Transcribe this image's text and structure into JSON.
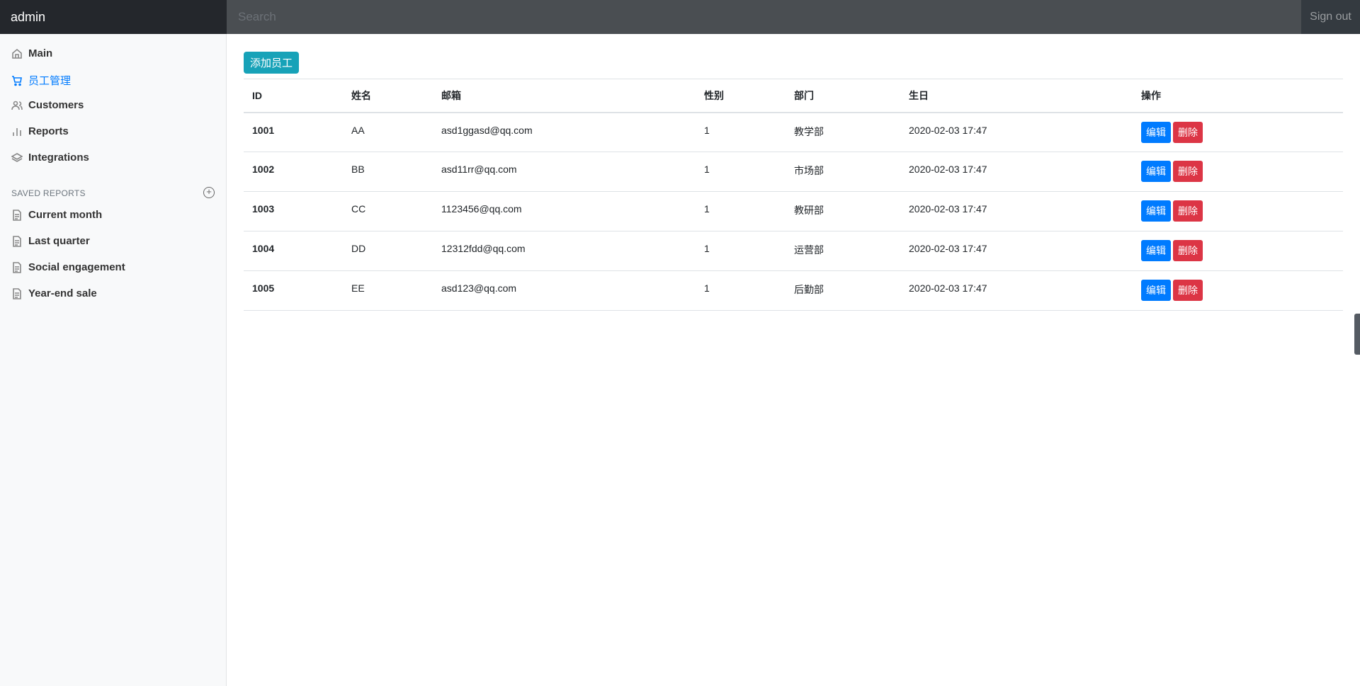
{
  "header": {
    "brand": "admin",
    "search_placeholder": "Search",
    "sign_out": "Sign out"
  },
  "sidebar": {
    "items": [
      {
        "label": "Main",
        "icon": "home-icon"
      },
      {
        "label": "员工管理",
        "icon": "cart-icon",
        "active": true
      },
      {
        "label": "Customers",
        "icon": "users-icon"
      },
      {
        "label": "Reports",
        "icon": "bar-chart-icon"
      },
      {
        "label": "Integrations",
        "icon": "layers-icon"
      }
    ],
    "saved_reports_title": "SAVED REPORTS",
    "saved_reports": [
      {
        "label": "Current month"
      },
      {
        "label": "Last quarter"
      },
      {
        "label": "Social engagement"
      },
      {
        "label": "Year-end sale"
      }
    ]
  },
  "main": {
    "add_button": "添加员工",
    "columns": [
      "ID",
      "姓名",
      "邮箱",
      "性别",
      "部门",
      "生日",
      "操作"
    ],
    "rows": [
      {
        "id": "1001",
        "name": "AA",
        "email": "asd1ggasd@qq.com",
        "gender": "1",
        "dept": "教学部",
        "birthday": "2020-02-03 17:47"
      },
      {
        "id": "1002",
        "name": "BB",
        "email": "asd11rr@qq.com",
        "gender": "1",
        "dept": "市场部",
        "birthday": "2020-02-03 17:47"
      },
      {
        "id": "1003",
        "name": "CC",
        "email": "1123456@qq.com",
        "gender": "1",
        "dept": "教研部",
        "birthday": "2020-02-03 17:47"
      },
      {
        "id": "1004",
        "name": "DD",
        "email": "12312fdd@qq.com",
        "gender": "1",
        "dept": "运营部",
        "birthday": "2020-02-03 17:47"
      },
      {
        "id": "1005",
        "name": "EE",
        "email": "asd123@qq.com",
        "gender": "1",
        "dept": "后勤部",
        "birthday": "2020-02-03 17:47"
      }
    ],
    "edit_label": "编辑",
    "delete_label": "删除"
  },
  "colors": {
    "accent": "#007bff",
    "info": "#17a2b8",
    "danger": "#dc3545",
    "topbar": "#343a40"
  }
}
